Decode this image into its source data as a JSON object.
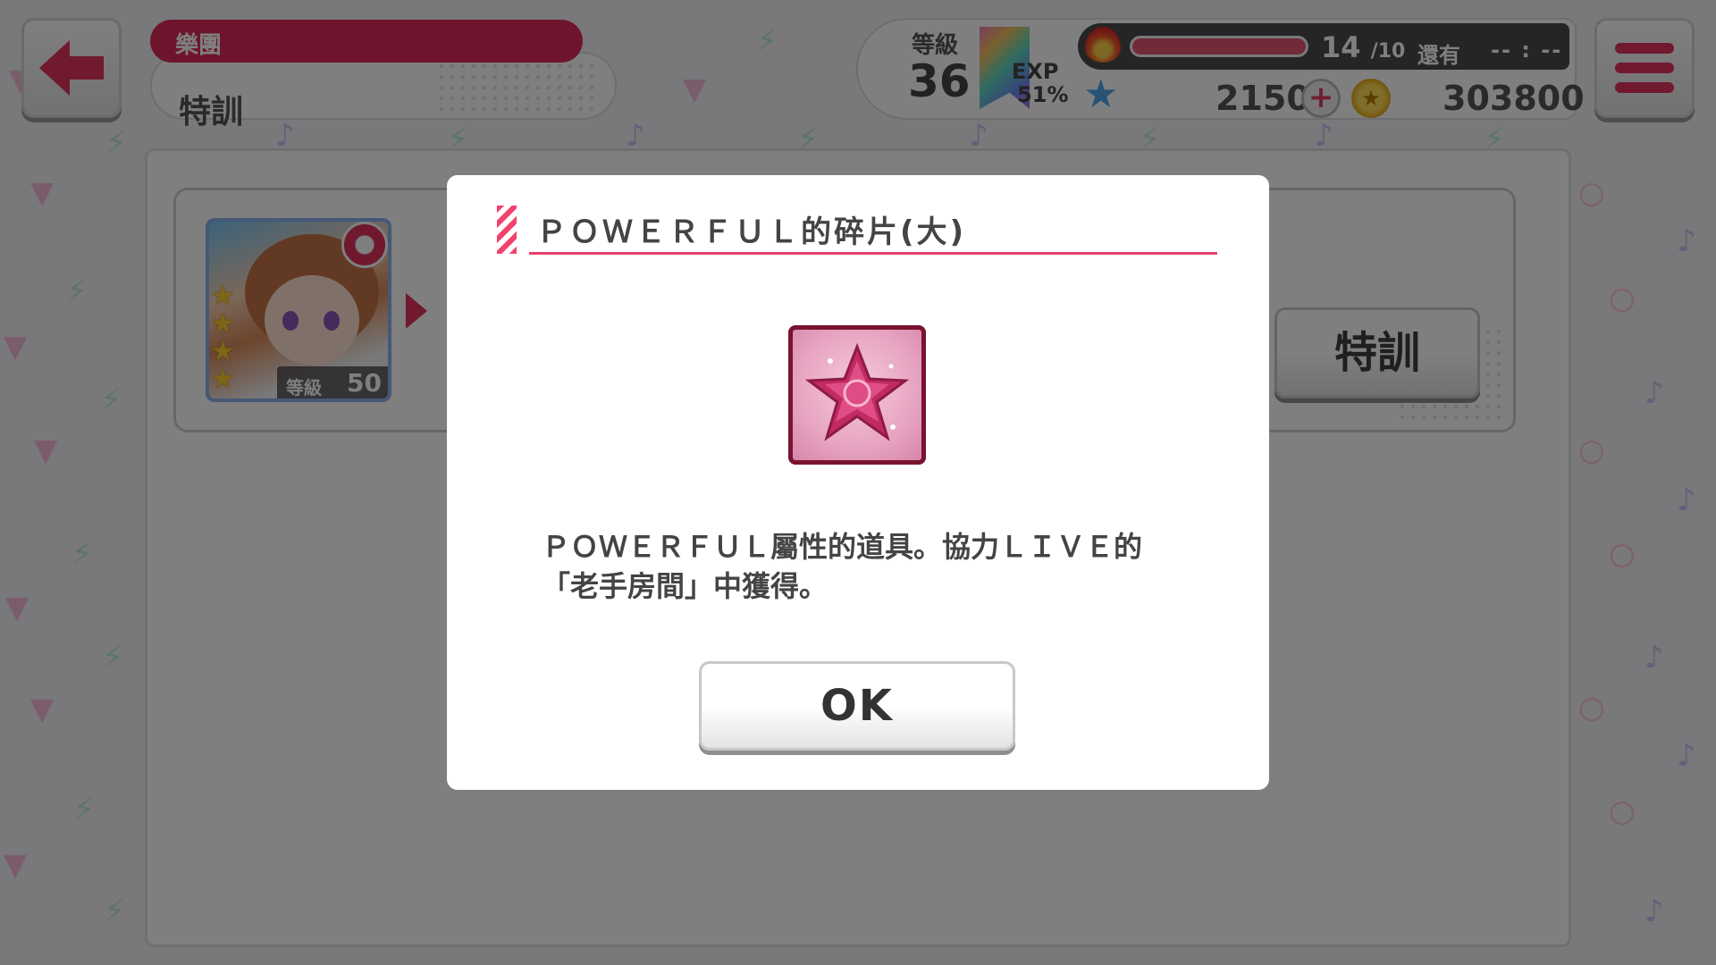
{
  "header": {
    "band_label": "樂團",
    "page_title": "特訓",
    "level_label": "等級",
    "level_value": "36",
    "exp_label": "EXP",
    "exp_value": "51%",
    "stamina_current": "14",
    "stamina_max": "/10",
    "stamina_fraction": 1.0,
    "remaining_label": "還有",
    "remaining_time": "-- : --",
    "stars_count": "2150",
    "coins_count": "303800"
  },
  "card": {
    "level_label": "等級",
    "level_value": "50",
    "rarity_stars": 4,
    "attribute": "powerful"
  },
  "train_button_label": "特訓",
  "modal": {
    "title": "ＰＯＷＥＲＦＵＬ的碎片(大)",
    "description_line1": "ＰＯＷＥＲＦＵＬ屬性的道具。協力ＬＩＶＥ的",
    "description_line2": "「老手房間」中獲得。",
    "ok_label": "OK"
  },
  "colors": {
    "accent": "#e1335e",
    "item_frame": "#7a1330",
    "star_gem": "#c12a63"
  },
  "icons": {
    "back": "back-arrow-icon",
    "menu": "hamburger-menu-icon",
    "stamina": "fire-icon",
    "stars": "star-gem-icon",
    "coins": "coin-icon",
    "item": "star-fragment-icon"
  }
}
